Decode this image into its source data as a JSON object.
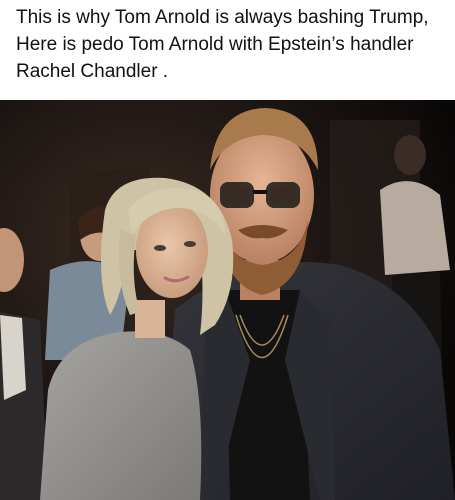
{
  "caption": {
    "text": "This is why Tom Arnold is always bashing Trump, Here is pedo Tom Arnold with Epstein’s handler Rachel Chandler ."
  },
  "photo": {
    "background_color": "#1a1412",
    "accent_colors": [
      "#cfc3a6",
      "#9a9794",
      "#2b2c31",
      "#b7885b"
    ]
  }
}
